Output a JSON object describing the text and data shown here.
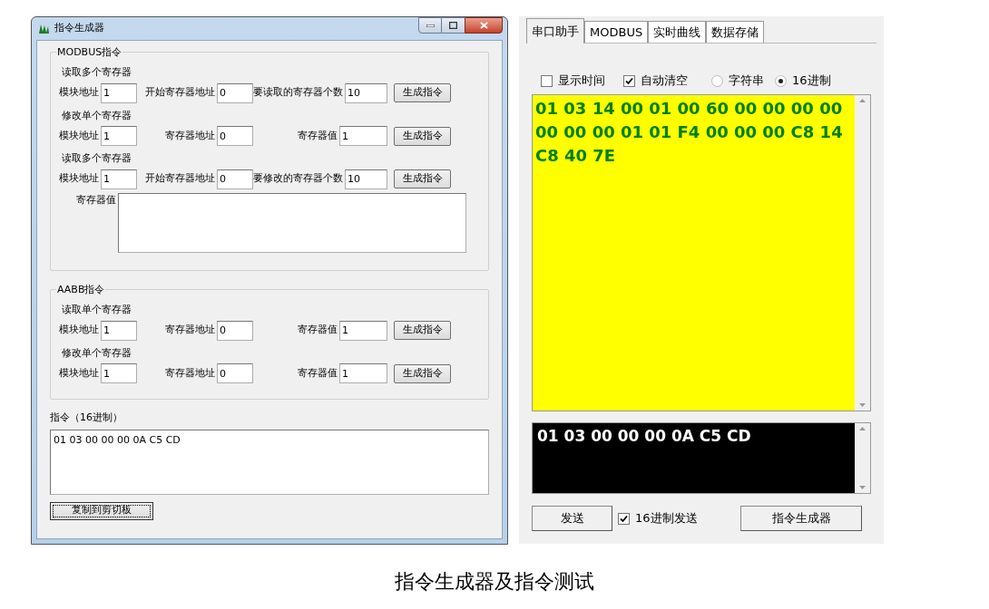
{
  "generator_window": {
    "title": "指令生成器",
    "groups": [
      {
        "title": "MODBUS指令",
        "sections": [
          {
            "title": "读取多个寄存器",
            "fields": [
              {
                "label": "模块地址",
                "value": "1"
              },
              {
                "label": "开始寄存器地址",
                "value": "0"
              },
              {
                "label": "要读取的寄存器个数",
                "value": "10"
              }
            ],
            "button": "生成指令"
          },
          {
            "title": "修改单个寄存器",
            "fields": [
              {
                "label": "模块地址",
                "value": "1"
              },
              {
                "label": "寄存器地址",
                "value": "0"
              },
              {
                "label": "寄存器值",
                "value": "1"
              }
            ],
            "button": "生成指令"
          },
          {
            "title": "读取多个寄存器",
            "fields": [
              {
                "label": "模块地址",
                "value": "1"
              },
              {
                "label": "开始寄存器地址",
                "value": "0"
              },
              {
                "label": "要修改的寄存器个数",
                "value": "10"
              }
            ],
            "button": "生成指令",
            "values_field": {
              "label": "寄存器值"
            }
          }
        ]
      },
      {
        "title": "AABB指令",
        "sections": [
          {
            "title": "读取单个寄存器",
            "fields": [
              {
                "label": "模块地址",
                "value": "1"
              },
              {
                "label": "寄存器地址",
                "value": "0"
              },
              {
                "label": "寄存器值",
                "value": "1"
              }
            ],
            "button": "生成指令"
          },
          {
            "title": "修改单个寄存器",
            "fields": [
              {
                "label": "模块地址",
                "value": "1"
              },
              {
                "label": "寄存器地址",
                "value": "0"
              },
              {
                "label": "寄存器值",
                "value": "1"
              }
            ],
            "button": "生成指令"
          }
        ]
      }
    ],
    "output": {
      "label": "指令（16进制）",
      "value": "01 03 00 00 00 0A C5 CD"
    },
    "copy_button": {
      "label": "复制到剪切板",
      "focused": true
    }
  },
  "serial_panel": {
    "tabs": [
      {
        "label": "串口助手",
        "selected": true
      },
      {
        "label": "MODBUS",
        "selected": false
      },
      {
        "label": "实时曲线",
        "selected": false
      },
      {
        "label": "数据存储",
        "selected": false
      }
    ],
    "options": [
      {
        "kind": "checkbox",
        "label": "显示时间",
        "checked": false
      },
      {
        "kind": "checkbox",
        "label": "自动清空",
        "checked": true
      },
      {
        "kind": "radio",
        "label": "字符串",
        "selected": false
      },
      {
        "kind": "radio",
        "label": "16进制",
        "selected": true
      }
    ],
    "receive_text": "01 03 14 00 01 00 60 00 00 00 00 00 00 00 01 01 F4 00 00 00 C8 14 C8 40 7E",
    "send_text": "01 03 00 00 00 0A C5 CD",
    "send_button": "发送",
    "hex_send": {
      "label": "16进制发送",
      "checked": true
    },
    "generator_button": "指令生成器"
  },
  "caption": "指令生成器及指令测试"
}
